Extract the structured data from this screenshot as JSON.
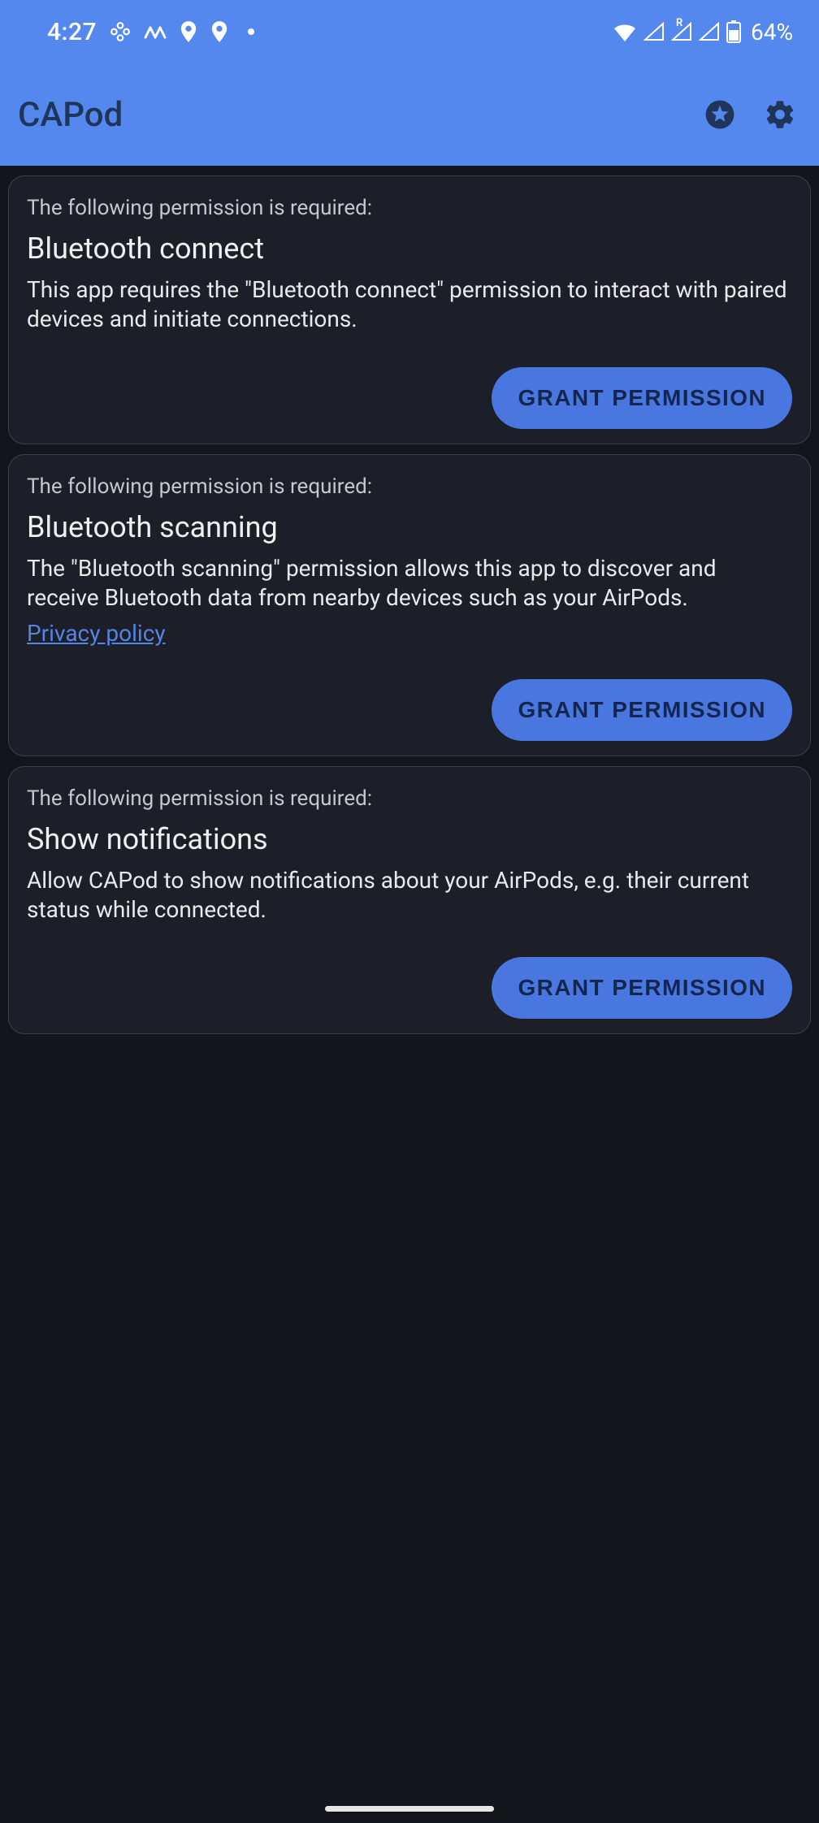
{
  "status": {
    "time": "4:27",
    "battery_text": "64%"
  },
  "appbar": {
    "title": "CAPod"
  },
  "cards": [
    {
      "preamble": "The following permission is required:",
      "title": "Bluetooth connect",
      "description": "This app requires the \"Bluetooth connect\" permission to interact with paired devices and initiate connections.",
      "link_text": null,
      "button_label": "GRANT PERMISSION"
    },
    {
      "preamble": "The following permission is required:",
      "title": "Bluetooth scanning",
      "description": "The \"Bluetooth scanning\" permission allows this app to discover and receive Bluetooth data from nearby devices such as your AirPods.",
      "link_text": "Privacy policy",
      "button_label": "GRANT PERMISSION"
    },
    {
      "preamble": "The following permission is required:",
      "title": "Show notifications",
      "description": "Allow CAPod to show notifications about your AirPods, e.g. their current status while connected.",
      "link_text": null,
      "button_label": "GRANT PERMISSION"
    }
  ]
}
